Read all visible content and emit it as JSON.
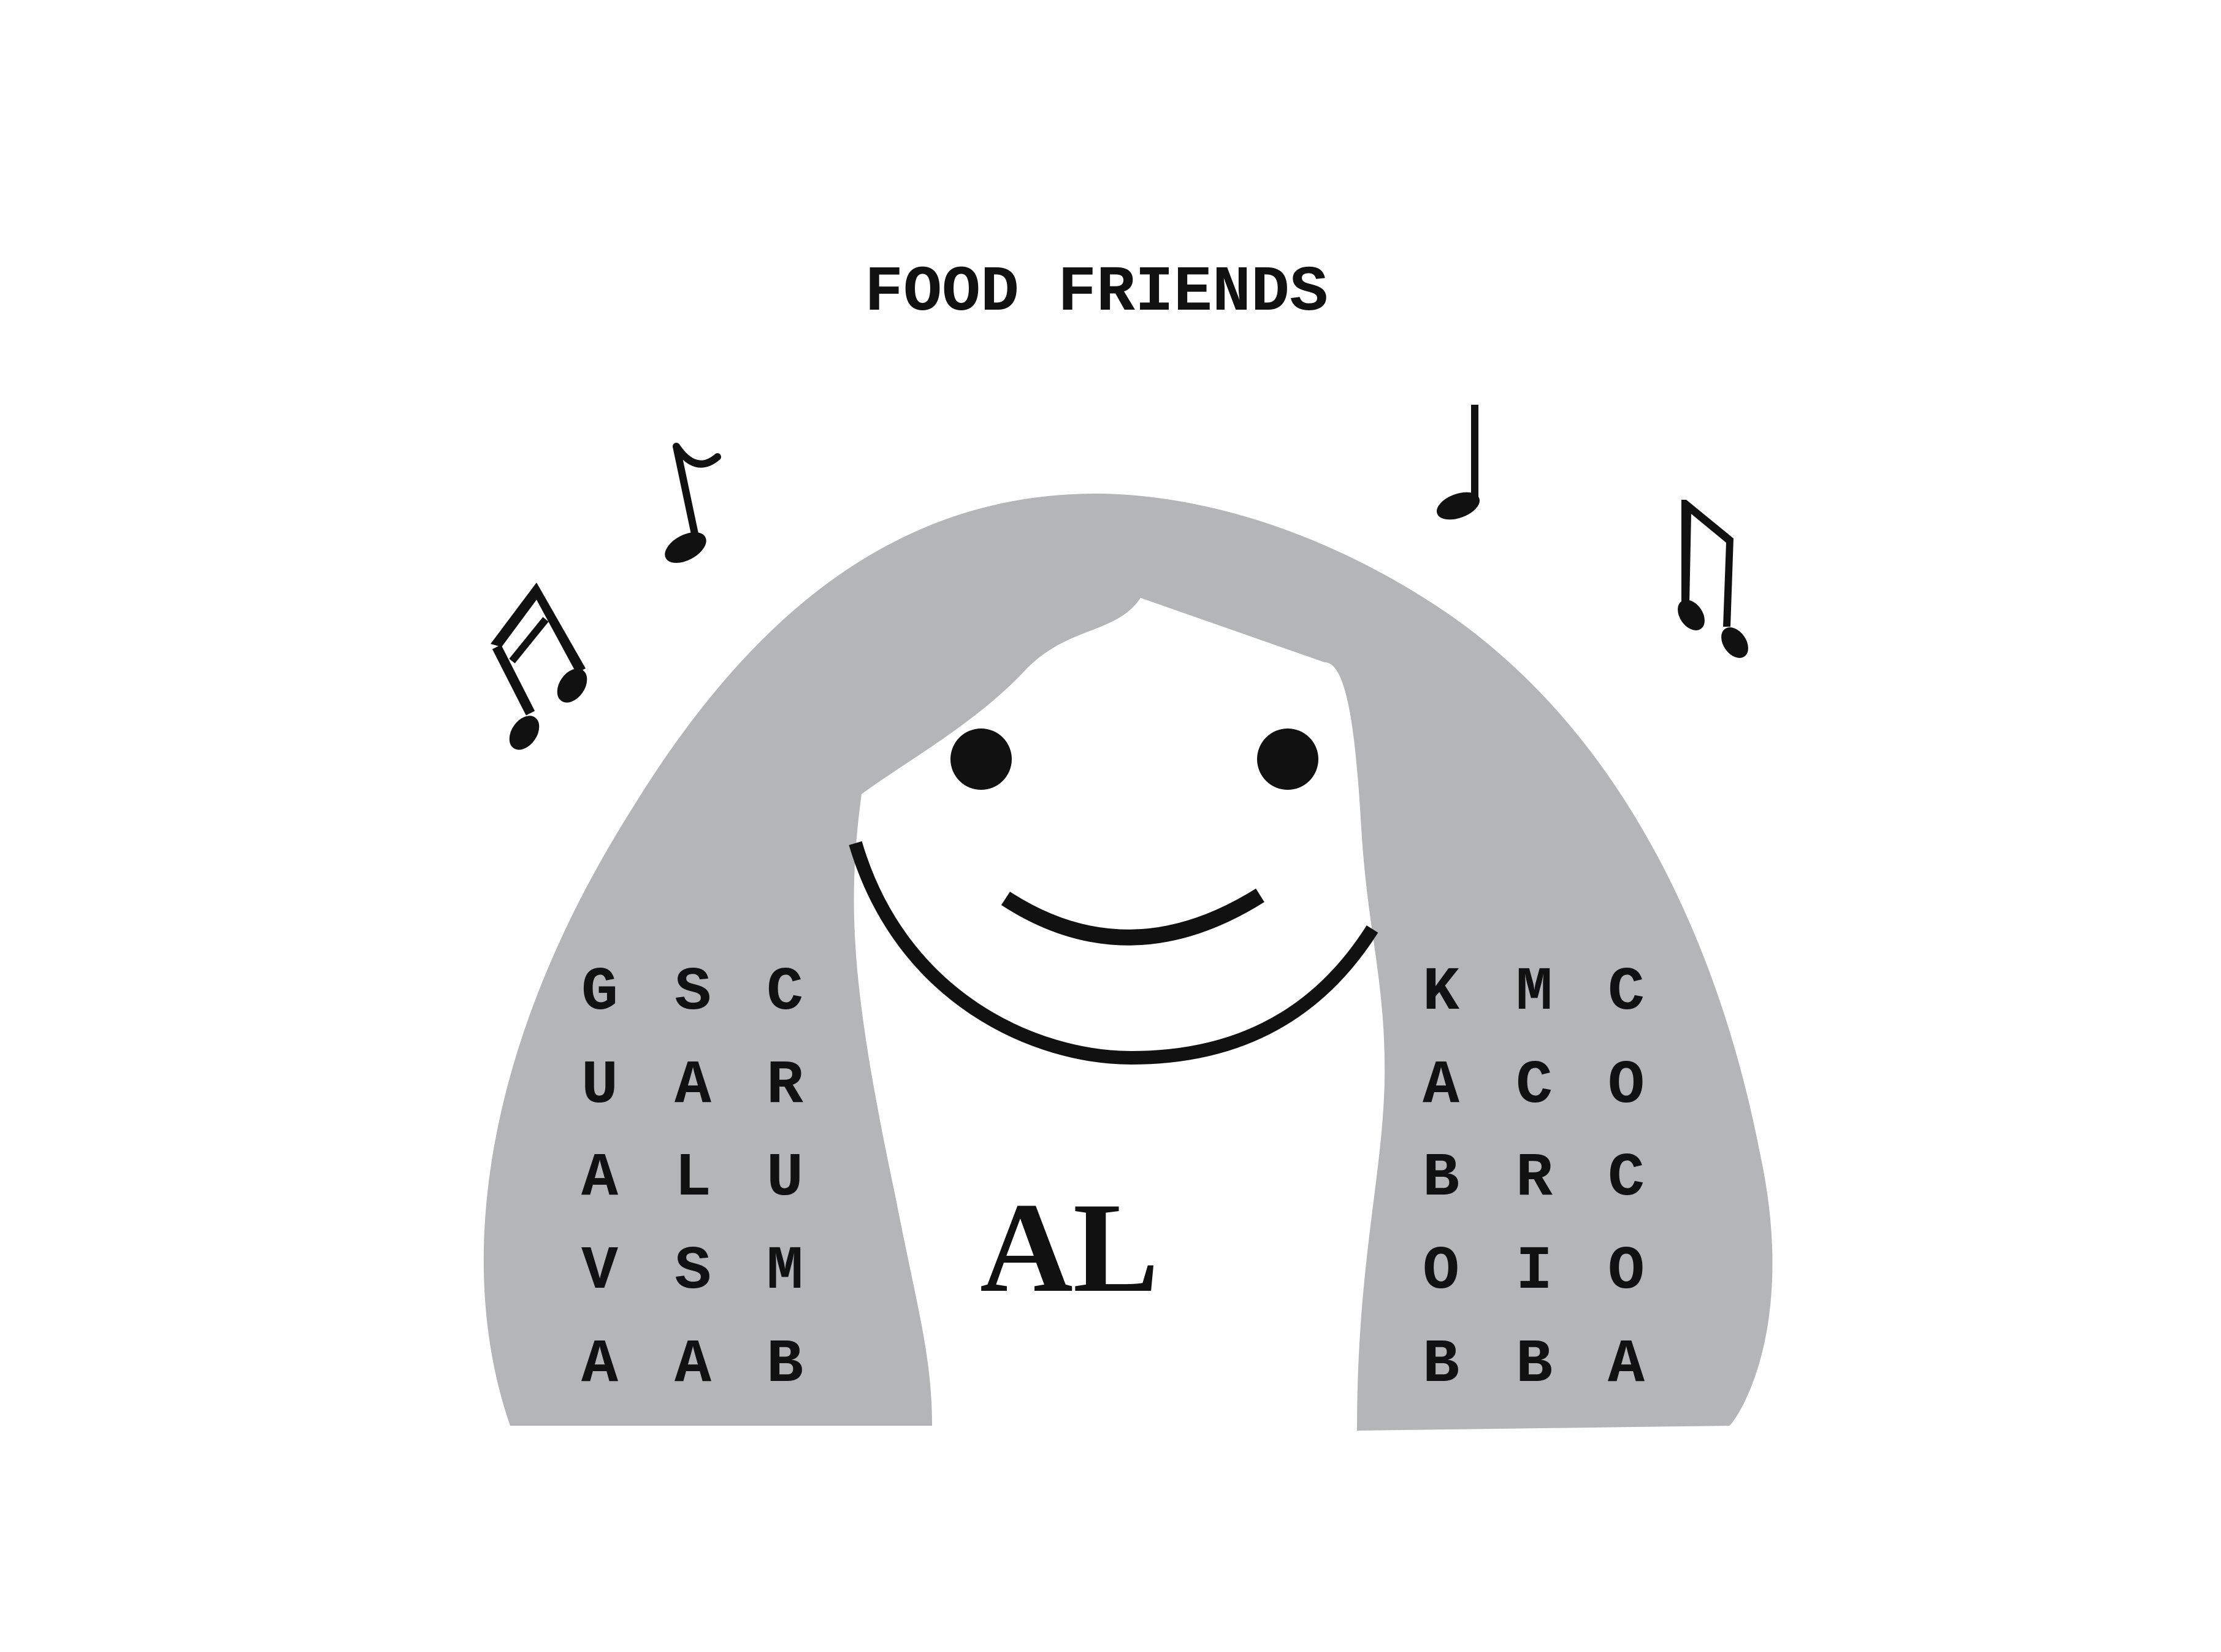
{
  "title": "FOOD FRIENDS",
  "character_name": "AL",
  "colors": {
    "hair": "#b4b5b8",
    "ink": "#111111",
    "background": "#ffffff"
  },
  "icons": [
    "beamed-eighth-notes-icon",
    "eighth-note-icon",
    "quarter-note-icon",
    "beamed-eighth-notes-icon"
  ],
  "left_grid": [
    [
      "G",
      "S",
      "C"
    ],
    [
      "U",
      "A",
      "R"
    ],
    [
      "A",
      "L",
      "U"
    ],
    [
      "V",
      "S",
      "M"
    ],
    [
      "A",
      "A",
      "B"
    ]
  ],
  "right_grid": [
    [
      "K",
      "M",
      "C"
    ],
    [
      "A",
      "C",
      "O"
    ],
    [
      "B",
      "R",
      "C"
    ],
    [
      "O",
      "I",
      "O"
    ],
    [
      "B",
      "B",
      "A"
    ]
  ]
}
